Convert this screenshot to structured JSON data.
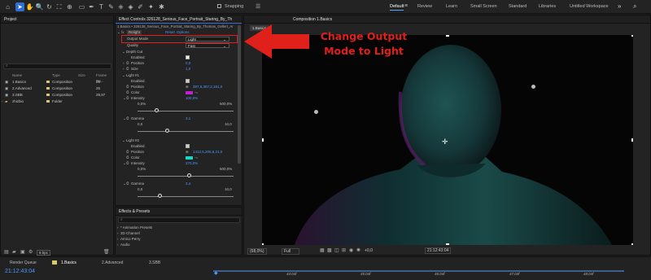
{
  "toolbar": {
    "snapping_label": "Snapping",
    "workspaces": [
      "Default",
      "Review",
      "Learn",
      "Small Screen",
      "Standard",
      "Libraries",
      "Untitled Workspace"
    ],
    "active_workspace": "Default"
  },
  "project": {
    "title": "Project",
    "search_placeholder": "",
    "columns": [
      "Name",
      "Type",
      "Size",
      "Frame Ra..."
    ],
    "items": [
      {
        "name": "1.Basics",
        "type": "Composition",
        "size": "",
        "fps": "25",
        "color": "#d9c86a"
      },
      {
        "name": "2.Advanced",
        "type": "Composition",
        "size": "",
        "fps": "25",
        "color": "#d9c86a"
      },
      {
        "name": "3.SBB",
        "type": "Composition",
        "size": "",
        "fps": "29,97",
        "color": "#d9c86a"
      },
      {
        "name": "zhizbio",
        "type": "Folder",
        "size": "",
        "fps": "",
        "color": "#d9c86a"
      }
    ],
    "bpc_label": "8 bpc"
  },
  "effect_controls": {
    "tab_title": "Effect Controls 326128_Serious_Face_Portrait_Staring_By_Th",
    "subtitle": "1.Basics • 326128_Serious_Face_Portrait_Staring_By_Thomas_Gellert_Ar",
    "effect_name": "Relight",
    "reset_label": "Reset",
    "options_label": "Options",
    "output_mode_label": "Output Mode",
    "output_mode_value": "Light",
    "quality_label": "Quality",
    "quality_value": "Fast",
    "depth_cut_label": "Depth Cut",
    "enabled_label": "Enabled",
    "position_label": "Position",
    "size_label": "Size",
    "depth_position": "0,0",
    "depth_size": "1,0",
    "light1_label": "Light #1",
    "light1_position": "387,6,387,2,161,0",
    "color_label": "Color",
    "intensity_label": "Intensity",
    "light1_intensity": "100,0%",
    "intensity_min": "0,0%",
    "intensity_max": "500,0%",
    "light1_intensity_frac": 0.2,
    "gamma_label": "Gamma",
    "light1_gamma": "3,1",
    "gamma_min": "0,0",
    "gamma_max": "10,0",
    "light1_gamma_frac": 0.31,
    "light2_label": "Light #2",
    "light2_position": "1412,5,205,6,21,0",
    "light2_intensity": "270,0%",
    "light2_intensity_frac": 0.54,
    "light2_gamma": "2,4",
    "light2_gamma_frac": 0.24,
    "light1_color": "#c21fd0",
    "light2_color": "#1bd6c4"
  },
  "presets": {
    "title": "Effects & Presets",
    "search_placeholder": "",
    "items": [
      "* Animation Presets",
      "3D Channel",
      "Amico Perry",
      "Audio"
    ]
  },
  "composition": {
    "tab_title": "Composition 1.Basics",
    "breadcrumb": "1.Basics",
    "zoom": "(68,0%)",
    "resolution": "Full",
    "exposure": "+0,0",
    "timecode": "21:12:43:04"
  },
  "annotation": {
    "line1": "Change Output",
    "line2": "Mode to Light"
  },
  "timeline": {
    "render_queue": "Render Queue",
    "tabs": [
      "1.Basics",
      "2.Advanced",
      "3.SBB"
    ],
    "timecode": "21:12:43:04",
    "ticks": [
      "44:04f",
      "45:04f",
      "46:04f",
      "47:04f",
      "48:04f"
    ]
  },
  "colors": {
    "accent": "#2d6fd6",
    "annotation": "#e0201a",
    "highlight_box": "#e0201a"
  }
}
